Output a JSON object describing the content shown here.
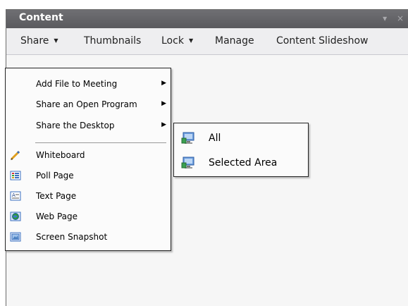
{
  "panel": {
    "title": "Content",
    "controls": [
      "▾",
      "×"
    ]
  },
  "toolbar": {
    "share": "Share",
    "thumbnails": "Thumbnails",
    "lock": "Lock",
    "manage": "Manage",
    "slideshow": "Content Slideshow",
    "dropdown_arrow": "▼"
  },
  "menu": {
    "items": [
      {
        "label": "Add File to Meeting",
        "submenu": "▶"
      },
      {
        "label": "Share an Open Program",
        "submenu": "▶"
      },
      {
        "label": "Share the Desktop",
        "submenu": "▶"
      },
      {
        "label": "Whiteboard",
        "icon": "whiteboard-icon"
      },
      {
        "label": "Poll Page",
        "icon": "poll-page-icon"
      },
      {
        "label": "Text Page",
        "icon": "text-page-icon"
      },
      {
        "label": "Web Page",
        "icon": "web-page-icon"
      },
      {
        "label": "Screen Snapshot",
        "icon": "screen-snapshot-icon"
      }
    ]
  },
  "submenu": {
    "items": [
      {
        "label": "All",
        "icon": "desktop-all-icon"
      },
      {
        "label": "Selected Area",
        "icon": "desktop-selected-area-icon"
      }
    ]
  }
}
